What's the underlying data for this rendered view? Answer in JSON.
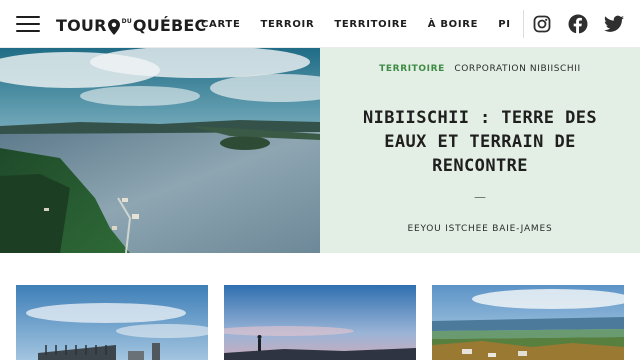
{
  "header": {
    "logo_text_1": "TOUR",
    "logo_text_du": "DU",
    "logo_text_2": "QUÉBEC",
    "nav": [
      {
        "label": "CARTE"
      },
      {
        "label": "TERROIR"
      },
      {
        "label": "TERRITOIRE"
      },
      {
        "label": "À BOIRE"
      },
      {
        "label": "PIGNON S"
      }
    ],
    "social": [
      "instagram-icon",
      "facebook-icon",
      "twitter-icon"
    ]
  },
  "hero": {
    "category": "TERRITOIRE",
    "author": "CORPORATION NIBIISCHII",
    "title": "NIBIISCHII : TERRE DES EAUX ET TERRAIN DE RENCONTRE",
    "dash": "—",
    "region": "EEYOU ISTCHEE BAIE-JAMES"
  },
  "colors": {
    "accent_green": "#3e8b46",
    "panel_bg": "#e3efe4",
    "text_dark": "#1f1f1f"
  }
}
